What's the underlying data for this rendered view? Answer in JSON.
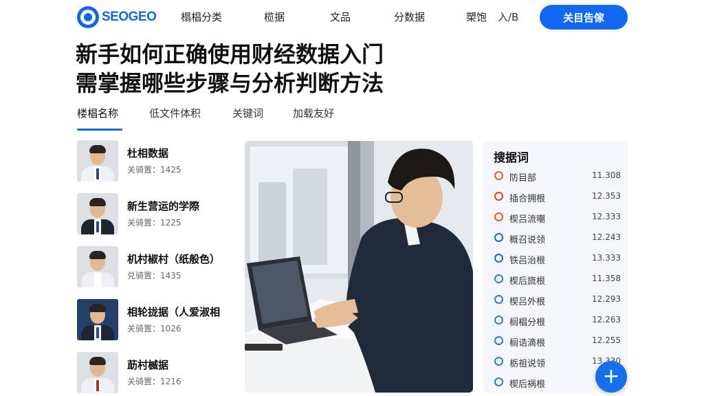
{
  "header": {
    "logo_text": "SEOGEO",
    "nav": [
      "榻椙分类",
      "榄据",
      "文品",
      "分数据",
      "槊饱"
    ],
    "login": "入/B",
    "cta": "关目告傢"
  },
  "title": {
    "line1": "新手如何正确使用财经数据入门",
    "line2": "需掌握哪些步骤与分析判断方法"
  },
  "tabs": [
    "楼椙名称",
    "低文件体积",
    "关键词",
    "加载友好"
  ],
  "authors": [
    {
      "name": "杜相数据",
      "meta": "关骑置：1425"
    },
    {
      "name": "新生营运的学際",
      "meta": "关骑置：1225"
    },
    {
      "name": "机村椒村（纸般色）",
      "meta": "兑骑置：1435"
    },
    {
      "name": "相轮拢据（人爱淑相",
      "meta": "关骑置：1026"
    },
    {
      "name": "莇村楲据",
      "meta": "关骑置：1216"
    }
  ],
  "panel": {
    "title": "搜据词",
    "rows": [
      {
        "label": "防目部",
        "value": "11.308",
        "icon": "fire-icon",
        "color": "#e0632a"
      },
      {
        "label": "插合拥根",
        "value": "12.353",
        "icon": "heart-icon",
        "color": "#d9462f"
      },
      {
        "label": "楔吕流嘲",
        "value": "12.333",
        "icon": "shield-icon",
        "color": "#e05a2a"
      },
      {
        "label": "概召说领",
        "value": "12.243",
        "icon": "filter-icon",
        "color": "#1f63d1"
      },
      {
        "label": "铁吕治根",
        "value": "13.333",
        "icon": "square-icon",
        "color": "#1f63d1"
      },
      {
        "label": "楔后旒根",
        "value": "11.358",
        "icon": "badge-icon",
        "color": "#2f78dd"
      },
      {
        "label": "楔吕外根",
        "value": "12.293",
        "icon": "globe-icon",
        "color": "#2f78dd"
      },
      {
        "label": "榈椙分根",
        "value": "12.263",
        "icon": "clock-icon",
        "color": "#2f78dd"
      },
      {
        "label": "榈诰滴根",
        "value": "12.255",
        "icon": "user-icon",
        "color": "#2f78dd"
      },
      {
        "label": "栃祖说领",
        "value": "13.330",
        "icon": "drop-icon",
        "color": "#2f78dd"
      },
      {
        "label": "楔后祸根",
        "value": "",
        "icon": "circle-icon",
        "color": "#2f78dd"
      }
    ]
  },
  "fab": "+"
}
